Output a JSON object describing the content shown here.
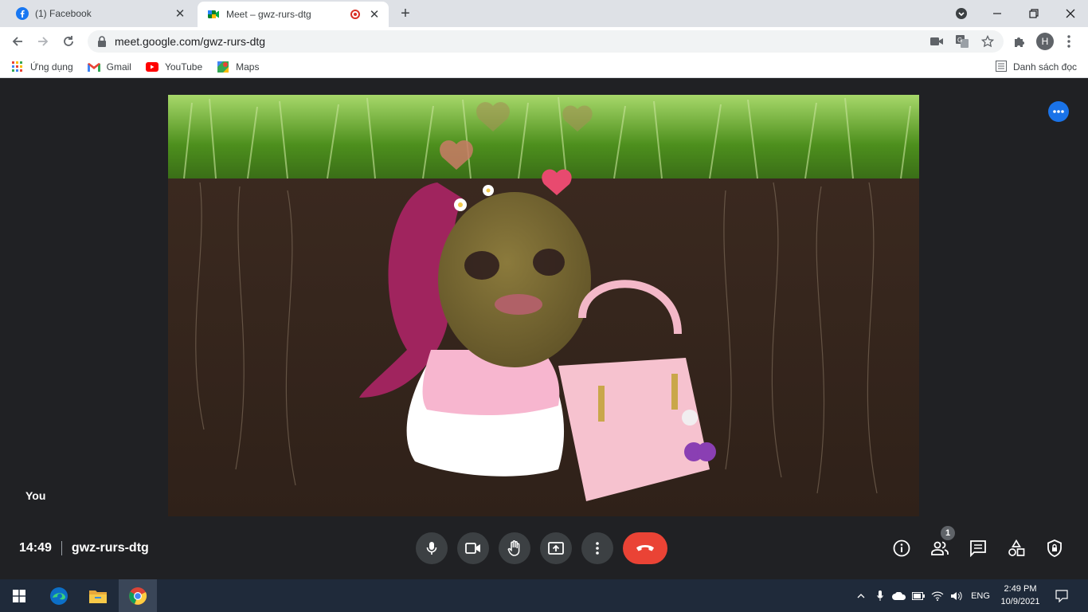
{
  "browser": {
    "tabs": [
      {
        "title": "(1) Facebook",
        "favicon": "facebook-icon",
        "active": false
      },
      {
        "title": "Meet – gwz-rurs-dtg",
        "favicon": "google-meet-icon",
        "active": true,
        "recording": true
      }
    ],
    "address": "meet.google.com/gwz-rurs-dtg",
    "profile_initial": "H",
    "bookmarks": [
      {
        "label": "Ứng dụng",
        "icon": "apps-grid-icon"
      },
      {
        "label": "Gmail",
        "icon": "gmail-icon"
      },
      {
        "label": "YouTube",
        "icon": "youtube-icon"
      },
      {
        "label": "Maps",
        "icon": "maps-icon"
      }
    ],
    "reading_list": "Danh sách đọc"
  },
  "meet": {
    "self_label": "You",
    "time": "14:49",
    "meeting_code": "gwz-rurs-dtg",
    "participants_count": "1",
    "controls": [
      "microphone-icon",
      "camera-icon",
      "raise-hand-icon",
      "present-screen-icon",
      "more-options-icon",
      "hang-up-icon"
    ],
    "right_controls": [
      "info-icon",
      "people-icon",
      "chat-icon",
      "activities-icon",
      "host-controls-icon"
    ]
  },
  "taskbar": {
    "apps": [
      "windows-start-icon",
      "edge-icon",
      "file-explorer-icon",
      "chrome-icon"
    ],
    "language": "ENG",
    "time": "2:49 PM",
    "date": "10/9/2021"
  },
  "colors": {
    "meet_background": "#202124",
    "accent_blue": "#1a73e8",
    "hangup_red": "#ea4335",
    "tab_strip": "#dee1e6",
    "taskbar": "#1f2a3a"
  }
}
